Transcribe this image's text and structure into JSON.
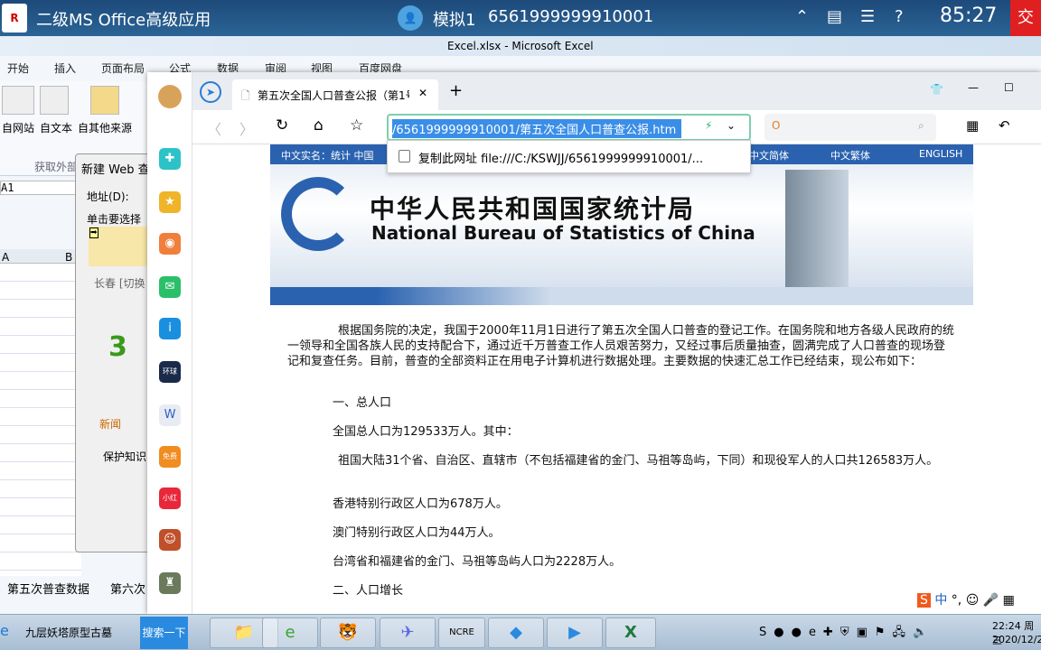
{
  "exam": {
    "title": "二级MS Office高级应用",
    "user": "模拟1",
    "id": "6561999999910001",
    "timer": "85:27",
    "submit": "交"
  },
  "excel": {
    "title": "Excel.xlsx - Microsoft Excel",
    "tabs": [
      "开始",
      "插入",
      "页面布局",
      "公式",
      "数据",
      "审阅",
      "视图",
      "百度网盘"
    ],
    "ribbon": [
      "自网站",
      "自文本",
      "自其他来源"
    ],
    "group": "获取外部",
    "namebox": "A1",
    "cols": [
      "A",
      "B"
    ],
    "sheets": [
      "第五次普查数据",
      "第六次"
    ]
  },
  "webquery": {
    "title": "新建 Web 查",
    "address_label": "地址(D):",
    "hint": "单击要选择",
    "city": "长春 [切换",
    "news": "新闻",
    "protect": "保护知识"
  },
  "browser": {
    "tab_title": "第五次全国人口普查公报（第1号",
    "url": "/6561999999910001/第五次全国人口普查公报.htm",
    "copy_url": "复制此网址 file:///C:/KSWJJ/6561999999910001/...",
    "banner": {
      "left": "中文实名：统计  中国",
      "links": [
        "中文简体",
        "中文繁体",
        "ENGLISH"
      ],
      "cn": "中华人民共和国国家统计局",
      "en": "National Bureau of Statistics of China"
    }
  },
  "article": {
    "intro": "根据国务院的决定，我国于2000年11月1日进行了第五次全国人口普查的登记工作。在国务院和地方各级人民政府的统一领导和全国各族人民的支持配合下，通过近千万普查工作人员艰苦努力，又经过事后质量抽查，圆满完成了人口普查的现场登记和复查任务。目前，普查的全部资料正在用电子计算机进行数据处理。主要数据的快速汇总工作已经结束，现公布如下：",
    "h1": "一、总人口",
    "total": "全国总人口为129533万人。其中：",
    "mainland": "祖国大陆31个省、自治区、直辖市（不包括福建省的金门、马祖等岛屿，下同）和现役军人的人口共126583万人。",
    "hk": "香港特别行政区人口为678万人。",
    "macau": "澳门特别行政区人口为44万人。",
    "tw": "台湾省和福建省的金门、马祖等岛屿人口为2228万人。",
    "h2": "二、人口增长"
  },
  "taskbar": {
    "search_text": "九层妖塔原型古墓",
    "search_btn": "搜索一下",
    "time": "22:24 周三",
    "date": "2020/12/2",
    "ime": "中"
  }
}
